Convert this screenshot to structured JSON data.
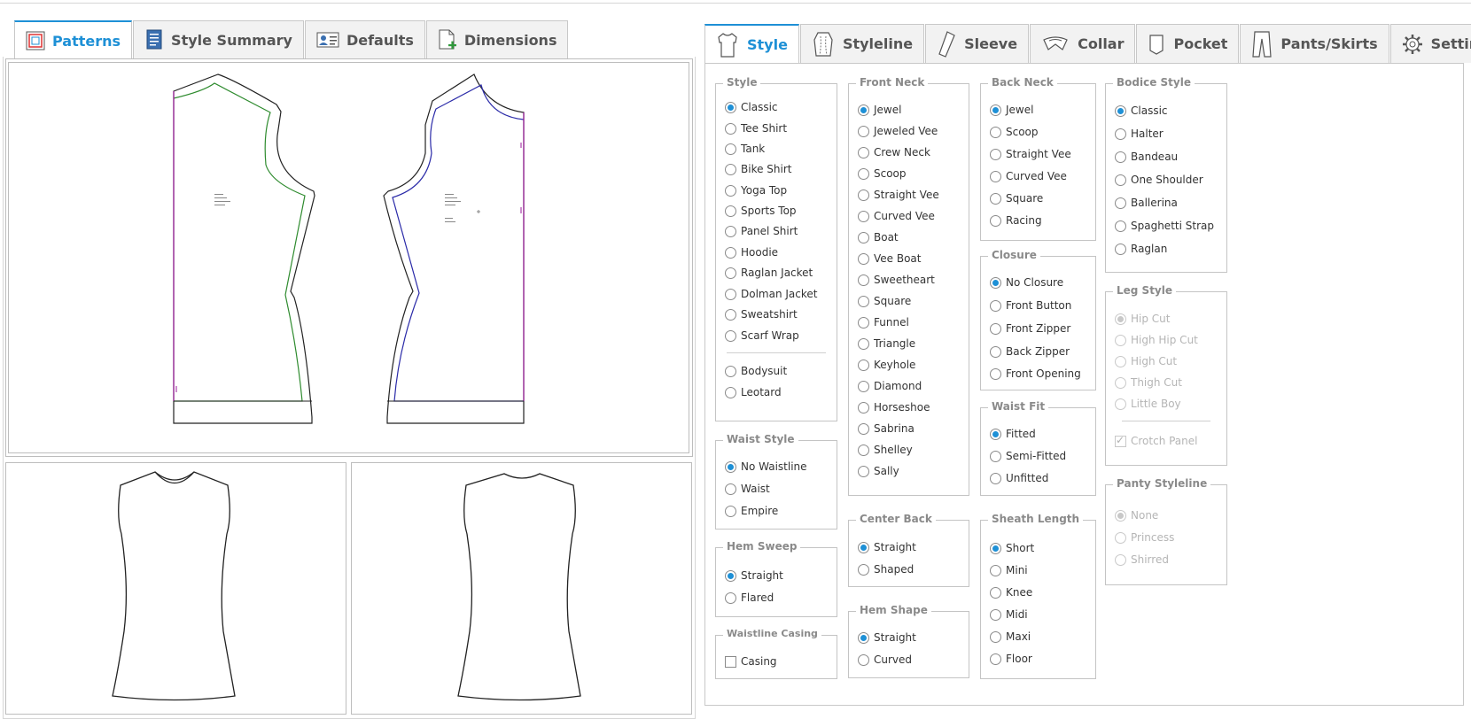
{
  "left_tabs": [
    {
      "label": "Patterns",
      "icon": "patterns-icon",
      "active": true
    },
    {
      "label": "Style Summary",
      "icon": "document-icon",
      "active": false
    },
    {
      "label": "Defaults",
      "icon": "contact-card-icon",
      "active": false
    },
    {
      "label": "Dimensions",
      "icon": "new-page-icon",
      "active": false
    }
  ],
  "right_tabs": [
    {
      "label": "Style",
      "icon": "shirt-icon",
      "active": true
    },
    {
      "label": "Styleline",
      "icon": "styleline-icon",
      "active": false
    },
    {
      "label": "Sleeve",
      "icon": "sleeve-icon",
      "active": false
    },
    {
      "label": "Collar",
      "icon": "collar-icon",
      "active": false
    },
    {
      "label": "Pocket",
      "icon": "pocket-icon",
      "active": false
    },
    {
      "label": "Pants/Skirts",
      "icon": "pants-icon",
      "active": false
    },
    {
      "label": "Settings",
      "icon": "gear-icon",
      "active": false
    }
  ],
  "groups": {
    "style": {
      "legend": "Style",
      "options": [
        "Classic",
        "Tee Shirt",
        "Tank",
        "Bike Shirt",
        "Yoga Top",
        "Sports Top",
        "Panel Shirt",
        "Hoodie",
        "Raglan Jacket",
        "Dolman Jacket",
        "Sweatshirt",
        "Scarf Wrap",
        "Bodysuit",
        "Leotard"
      ],
      "selected": "Classic"
    },
    "front_neck": {
      "legend": "Front Neck",
      "options": [
        "Jewel",
        "Jeweled Vee",
        "Crew Neck",
        "Scoop",
        "Straight Vee",
        "Curved Vee",
        "Boat",
        "Vee Boat",
        "Sweetheart",
        "Square",
        "Funnel",
        "Triangle",
        "Keyhole",
        "Diamond",
        "Horseshoe",
        "Sabrina",
        "Shelley",
        "Sally"
      ],
      "selected": "Jewel"
    },
    "back_neck": {
      "legend": "Back Neck",
      "options": [
        "Jewel",
        "Scoop",
        "Straight Vee",
        "Curved Vee",
        "Square",
        "Racing"
      ],
      "selected": "Jewel"
    },
    "bodice_style": {
      "legend": "Bodice Style",
      "options": [
        "Classic",
        "Halter",
        "Bandeau",
        "One Shoulder",
        "Ballerina",
        "Spaghetti Strap",
        "Raglan"
      ],
      "selected": "Classic"
    },
    "closure": {
      "legend": "Closure",
      "options": [
        "No Closure",
        "Front Button",
        "Front Zipper",
        "Back Zipper",
        "Front Opening"
      ],
      "selected": "No Closure"
    },
    "leg_style": {
      "legend": "Leg Style",
      "options": [
        "Hip Cut",
        "High Hip Cut",
        "High Cut",
        "Thigh Cut",
        "Little Boy"
      ],
      "selected": "Hip Cut",
      "disabled": true,
      "checkbox": {
        "label": "Crotch Panel",
        "checked": true
      }
    },
    "waist_style": {
      "legend": "Waist Style",
      "options": [
        "No Waistline",
        "Waist",
        "Empire"
      ],
      "selected": "No Waistline"
    },
    "waist_fit": {
      "legend": "Waist Fit",
      "options": [
        "Fitted",
        "Semi-Fitted",
        "Unfitted"
      ],
      "selected": "Fitted"
    },
    "panty_styleline": {
      "legend": "Panty Styleline",
      "options": [
        "None",
        "Princess",
        "Shirred"
      ],
      "selected": "None",
      "disabled": true
    },
    "center_back": {
      "legend": "Center Back",
      "options": [
        "Straight",
        "Shaped"
      ],
      "selected": "Straight"
    },
    "sheath_length": {
      "legend": "Sheath Length",
      "options": [
        "Short",
        "Mini",
        "Knee",
        "Midi",
        "Maxi",
        "Floor"
      ],
      "selected": "Short"
    },
    "hem_sweep": {
      "legend": "Hem Sweep",
      "options": [
        "Straight",
        "Flared"
      ],
      "selected": "Straight"
    },
    "hem_shape": {
      "legend": "Hem Shape",
      "options": [
        "Straight",
        "Curved"
      ],
      "selected": "Straight"
    },
    "waistline_casing": {
      "legend": "Waistline Casing",
      "checkbox": {
        "label": "Casing",
        "checked": false
      }
    }
  },
  "colors": {
    "accent": "#1e90d6",
    "front_seam": "#2e8b2e",
    "back_seam": "#2a2aa8",
    "grain": "#9b1b9b"
  }
}
